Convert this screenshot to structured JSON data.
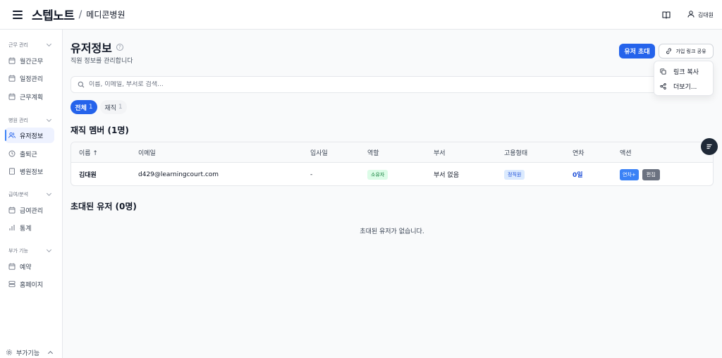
{
  "header": {
    "brand": "스텝노트",
    "separator": "/",
    "org": "메디콘병원",
    "user_name": "김대원"
  },
  "sidebar": {
    "sections": [
      {
        "title": "근무 관리",
        "items": [
          {
            "label": "월간근무",
            "icon": "calendar-icon"
          },
          {
            "label": "일정관리",
            "icon": "calendar-icon"
          },
          {
            "label": "근무계획",
            "icon": "calendar-icon"
          }
        ]
      },
      {
        "title": "병원 관리",
        "items": [
          {
            "label": "유저정보",
            "icon": "users-icon",
            "active": true
          },
          {
            "label": "출퇴근",
            "icon": "clock-icon"
          },
          {
            "label": "병원정보",
            "icon": "building-icon"
          }
        ]
      },
      {
        "title": "급여/분석",
        "items": [
          {
            "label": "급여관리",
            "icon": "calendar-icon"
          },
          {
            "label": "통계",
            "icon": "bar-chart-icon"
          }
        ]
      },
      {
        "title": "부가 기능",
        "items": [
          {
            "label": "예약",
            "icon": "calendar-icon"
          },
          {
            "label": "홈페이지",
            "icon": "layout-icon"
          }
        ]
      }
    ],
    "footer_label": "부가기능"
  },
  "page": {
    "title": "유저정보",
    "subtitle": "직원 정보를 관리합니다",
    "invite_button": "유저 초대",
    "share_button": "가입 링크 공유",
    "dropdown": {
      "copy_link": "링크 복사",
      "more": "더보기..."
    },
    "search_placeholder": "이름, 이메일, 부서로 검색...",
    "tabs": [
      {
        "label": "전체",
        "count": "1"
      },
      {
        "label": "재직",
        "count": "1"
      }
    ],
    "members_title": "재직 멤버 (1명)",
    "invited_title": "초대된 유저 (0명)",
    "invited_empty": "초대된 유저가 없습니다."
  },
  "table": {
    "columns": [
      "이름 ↑",
      "이메일",
      "입사일",
      "역할",
      "부서",
      "고용형태",
      "연차",
      "액션"
    ],
    "rows": [
      {
        "name": "김대원",
        "email": "d429@learningcourt.com",
        "join_date": "-",
        "role": "소유자",
        "department": "부서 없음",
        "employment": "정직원",
        "leave": "0일",
        "action_leave": "연차+",
        "action_edit": "편집"
      }
    ]
  },
  "colors": {
    "primary": "#2563eb",
    "role_badge": "#dcfce7",
    "employment_badge": "#dbeafe"
  }
}
